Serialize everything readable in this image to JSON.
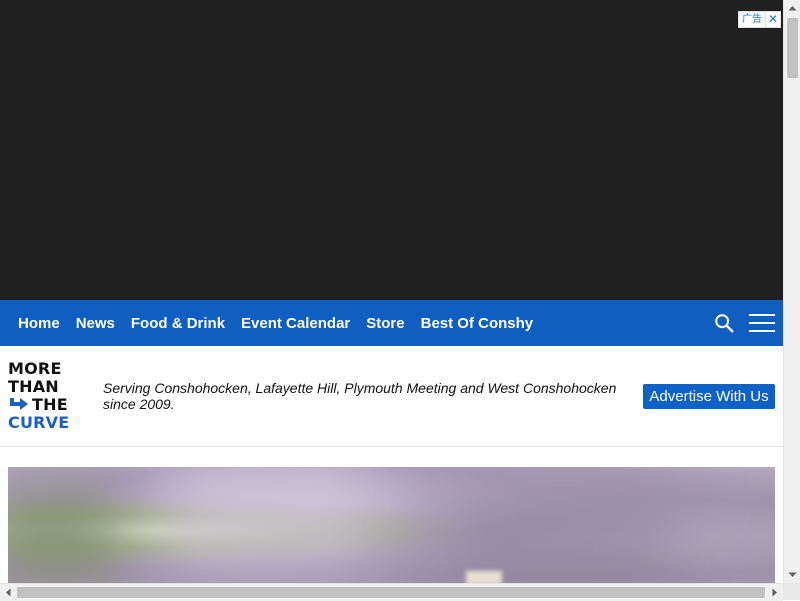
{
  "ad": {
    "badge_label": "广告",
    "close_glyph": "✕"
  },
  "nav": {
    "items": [
      {
        "label": "Home"
      },
      {
        "label": "News"
      },
      {
        "label": "Food & Drink"
      },
      {
        "label": "Event Calendar"
      },
      {
        "label": "Store"
      },
      {
        "label": "Best Of Conshy"
      }
    ],
    "icons": {
      "search": "search-icon",
      "menu": "hamburger-menu-icon"
    },
    "colors": {
      "background": "#0f5fc0",
      "text": "#ffffff"
    }
  },
  "header": {
    "logo_lines": [
      "MORE",
      "THAN",
      "THE",
      "CURVE"
    ],
    "tagline": "Serving Conshohocken, Lafayette Hill, Plymouth Meeting and West Conshohocken since 2009.",
    "advertise_label": "Advertise With Us",
    "colors": {
      "logo_dark": "#111111",
      "logo_blue": "#1a5fc1",
      "button_bg": "#0f62c5"
    }
  },
  "hero": {
    "description_shown": ""
  }
}
